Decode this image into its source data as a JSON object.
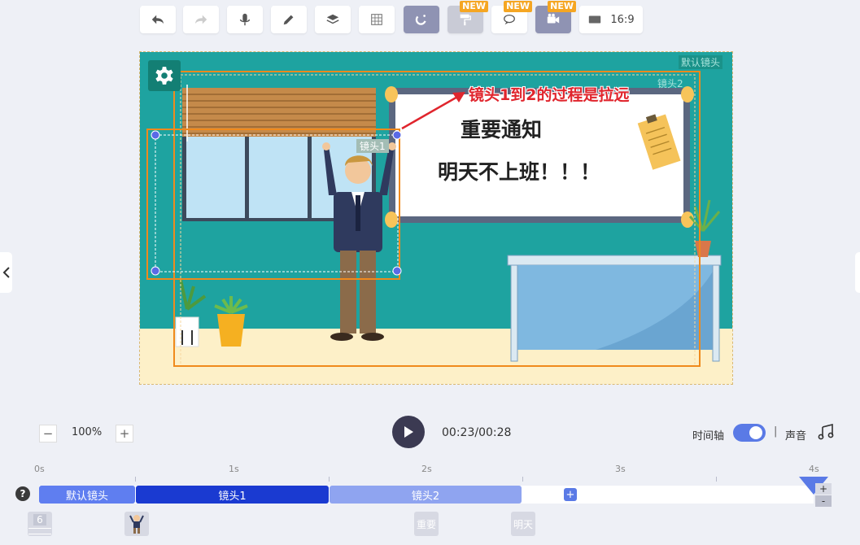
{
  "toolbar": {
    "new_badge": "NEW",
    "ratio_label": "16:9"
  },
  "canvas": {
    "default_camera_label": "默认镜头",
    "camera2_label": "镜头2",
    "camera1_label": "镜头1",
    "annotation": "镜头1到2的过程是拉远",
    "board_title": "重要通知",
    "board_text": "明天不上班！！！"
  },
  "controls": {
    "zoom_value": "100%",
    "minus": "−",
    "plus": "+",
    "time": "00:23/00:28",
    "timeline_label": "时间轴",
    "separator": "|",
    "sound_label": "声音"
  },
  "timeline": {
    "ticks": [
      "0s",
      "1s",
      "2s",
      "3s",
      "4s"
    ],
    "clips": [
      "默认镜头",
      "镜头1",
      "镜头2"
    ],
    "help": "?",
    "add": "+",
    "zoom_plus": "+",
    "zoom_minus": "-",
    "thumbs": [
      "6",
      "重要",
      "明天"
    ]
  },
  "colors": {
    "accent": "#5a7ae6",
    "clip_default": "#5f7ef0",
    "clip_active": "#1a3ad1",
    "clip_light": "#8fa4f0",
    "canvas_bg": "#1ea3a0",
    "camera_frame": "#f08a1c",
    "annotation": "#e0252d"
  }
}
